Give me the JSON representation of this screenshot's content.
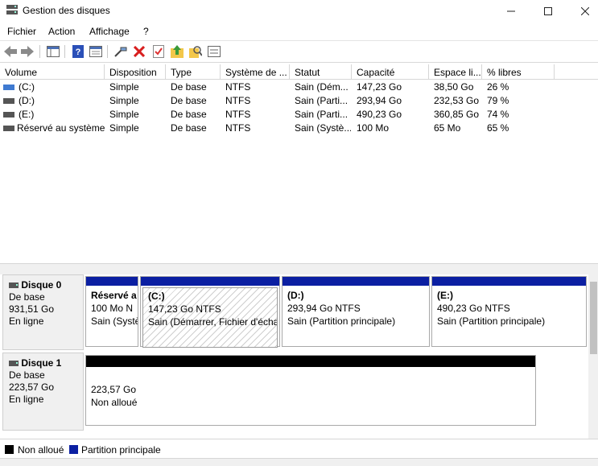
{
  "window": {
    "title": "Gestion des disques",
    "minimize": "—",
    "maximize": "☐",
    "close": "✕"
  },
  "menu": {
    "items": [
      "Fichier",
      "Action",
      "Affichage",
      "?"
    ]
  },
  "toolbar": {
    "icons": [
      "back-arrow-icon",
      "forward-arrow-icon",
      "console-tree-icon",
      "help-icon",
      "properties-icon",
      "connect-icon",
      "delete-icon",
      "check-icon",
      "up-arrow-icon",
      "search-icon",
      "settings-icon"
    ]
  },
  "columns": [
    "Volume",
    "Disposition",
    "Type",
    "Système de ...",
    "Statut",
    "Capacité",
    "Espace li...",
    "% libres"
  ],
  "volumes": [
    {
      "name": "(C:)",
      "layout": "Simple",
      "type": "De base",
      "fs": "NTFS",
      "status": "Sain (Dém...",
      "capacity": "147,23 Go",
      "free": "38,50 Go",
      "pct": "26 %"
    },
    {
      "name": "(D:)",
      "layout": "Simple",
      "type": "De base",
      "fs": "NTFS",
      "status": "Sain (Parti...",
      "capacity": "293,94 Go",
      "free": "232,53 Go",
      "pct": "79 %"
    },
    {
      "name": "(E:)",
      "layout": "Simple",
      "type": "De base",
      "fs": "NTFS",
      "status": "Sain (Parti...",
      "capacity": "490,23 Go",
      "free": "360,85 Go",
      "pct": "74 %"
    },
    {
      "name": "Réservé au système",
      "layout": "Simple",
      "type": "De base",
      "fs": "NTFS",
      "status": "Sain (Systè...",
      "capacity": "100 Mo",
      "free": "65 Mo",
      "pct": "65 %"
    }
  ],
  "disks": [
    {
      "name": "Disque 0",
      "kind": "De base",
      "size": "931,51 Go",
      "state": "En ligne",
      "partitions": [
        {
          "name": "Réservé a",
          "size": "100 Mo N",
          "status": "Sain (Systè"
        },
        {
          "name": "(C:)",
          "size": "147,23 Go NTFS",
          "status": "Sain (Démarrer, Fichier d'échar"
        },
        {
          "name": "(D:)",
          "size": "293,94 Go NTFS",
          "status": "Sain (Partition principale)"
        },
        {
          "name": "(E:)",
          "size": "490,23 Go NTFS",
          "status": "Sain (Partition principale)"
        }
      ]
    },
    {
      "name": "Disque 1",
      "kind": "De base",
      "size": "223,57 Go",
      "state": "En ligne",
      "partitions": [
        {
          "name": "",
          "size": "223,57 Go",
          "status": "Non alloué"
        }
      ]
    }
  ],
  "legend": [
    {
      "label": "Non alloué",
      "color": "#000000"
    },
    {
      "label": "Partition principale",
      "color": "#0b1fa2"
    }
  ],
  "colors": {
    "primary_partition": "#0b1fa2",
    "unallocated": "#000000"
  }
}
